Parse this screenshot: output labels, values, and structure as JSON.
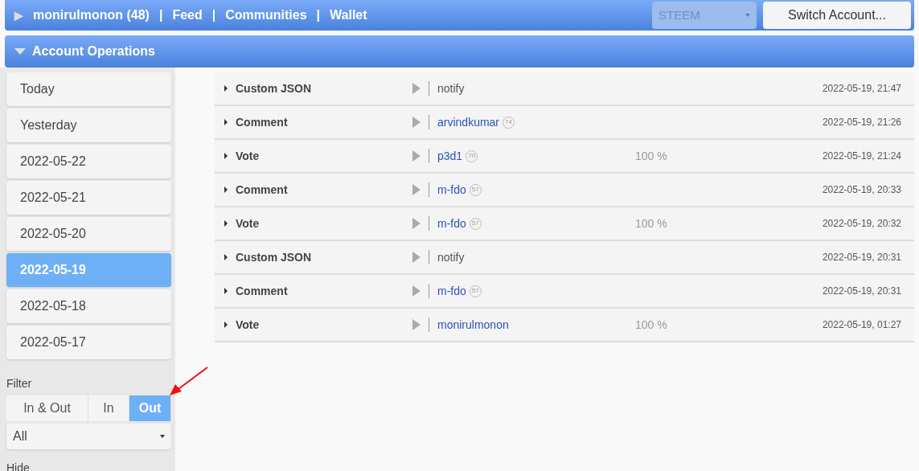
{
  "nav": {
    "arrow": "▶",
    "user": "monirulmonon (48)",
    "links": [
      "Feed",
      "Communities",
      "Wallet"
    ],
    "separator": "|"
  },
  "chain_select": {
    "value": "STEEM",
    "disabled": true
  },
  "switch_button": "Switch Account...",
  "section": {
    "title": "Account Operations",
    "expanded": true
  },
  "days": [
    {
      "label": "Today",
      "selected": false
    },
    {
      "label": "Yesterday",
      "selected": false
    },
    {
      "label": "2022-05-22",
      "selected": false
    },
    {
      "label": "2022-05-21",
      "selected": false
    },
    {
      "label": "2022-05-20",
      "selected": false
    },
    {
      "label": "2022-05-19",
      "selected": true
    },
    {
      "label": "2022-05-18",
      "selected": false
    },
    {
      "label": "2022-05-17",
      "selected": false
    }
  ],
  "filter": {
    "label": "Filter",
    "options": [
      {
        "label": "In & Out",
        "selected": false
      },
      {
        "label": "In",
        "selected": false
      },
      {
        "label": "Out",
        "selected": true
      }
    ],
    "type_select": "All"
  },
  "hide_label": "Hide",
  "operations": [
    {
      "type": "Custom JSON",
      "target": "notify",
      "kind": "text",
      "time": "2022-05-19, 21:47"
    },
    {
      "type": "Comment",
      "target": "arvindkumar",
      "reputation": "74",
      "kind": "account",
      "time": "2022-05-19, 21:26"
    },
    {
      "type": "Vote",
      "target": "p3d1",
      "reputation": "70",
      "kind": "account",
      "weight": "100 %",
      "time": "2022-05-19, 21:24"
    },
    {
      "type": "Comment",
      "target": "m-fdo",
      "reputation": "57",
      "kind": "account",
      "time": "2022-05-19, 20:33"
    },
    {
      "type": "Vote",
      "target": "m-fdo",
      "reputation": "57",
      "kind": "account",
      "weight": "100 %",
      "time": "2022-05-19, 20:32"
    },
    {
      "type": "Custom JSON",
      "target": "notify",
      "kind": "text",
      "time": "2022-05-19, 20:31"
    },
    {
      "type": "Comment",
      "target": "m-fdo",
      "reputation": "57",
      "kind": "account",
      "time": "2022-05-19, 20:31"
    },
    {
      "type": "Vote",
      "target": "monirulmonon",
      "kind": "account",
      "weight": "100 %",
      "time": "2022-05-19, 01:27"
    }
  ]
}
